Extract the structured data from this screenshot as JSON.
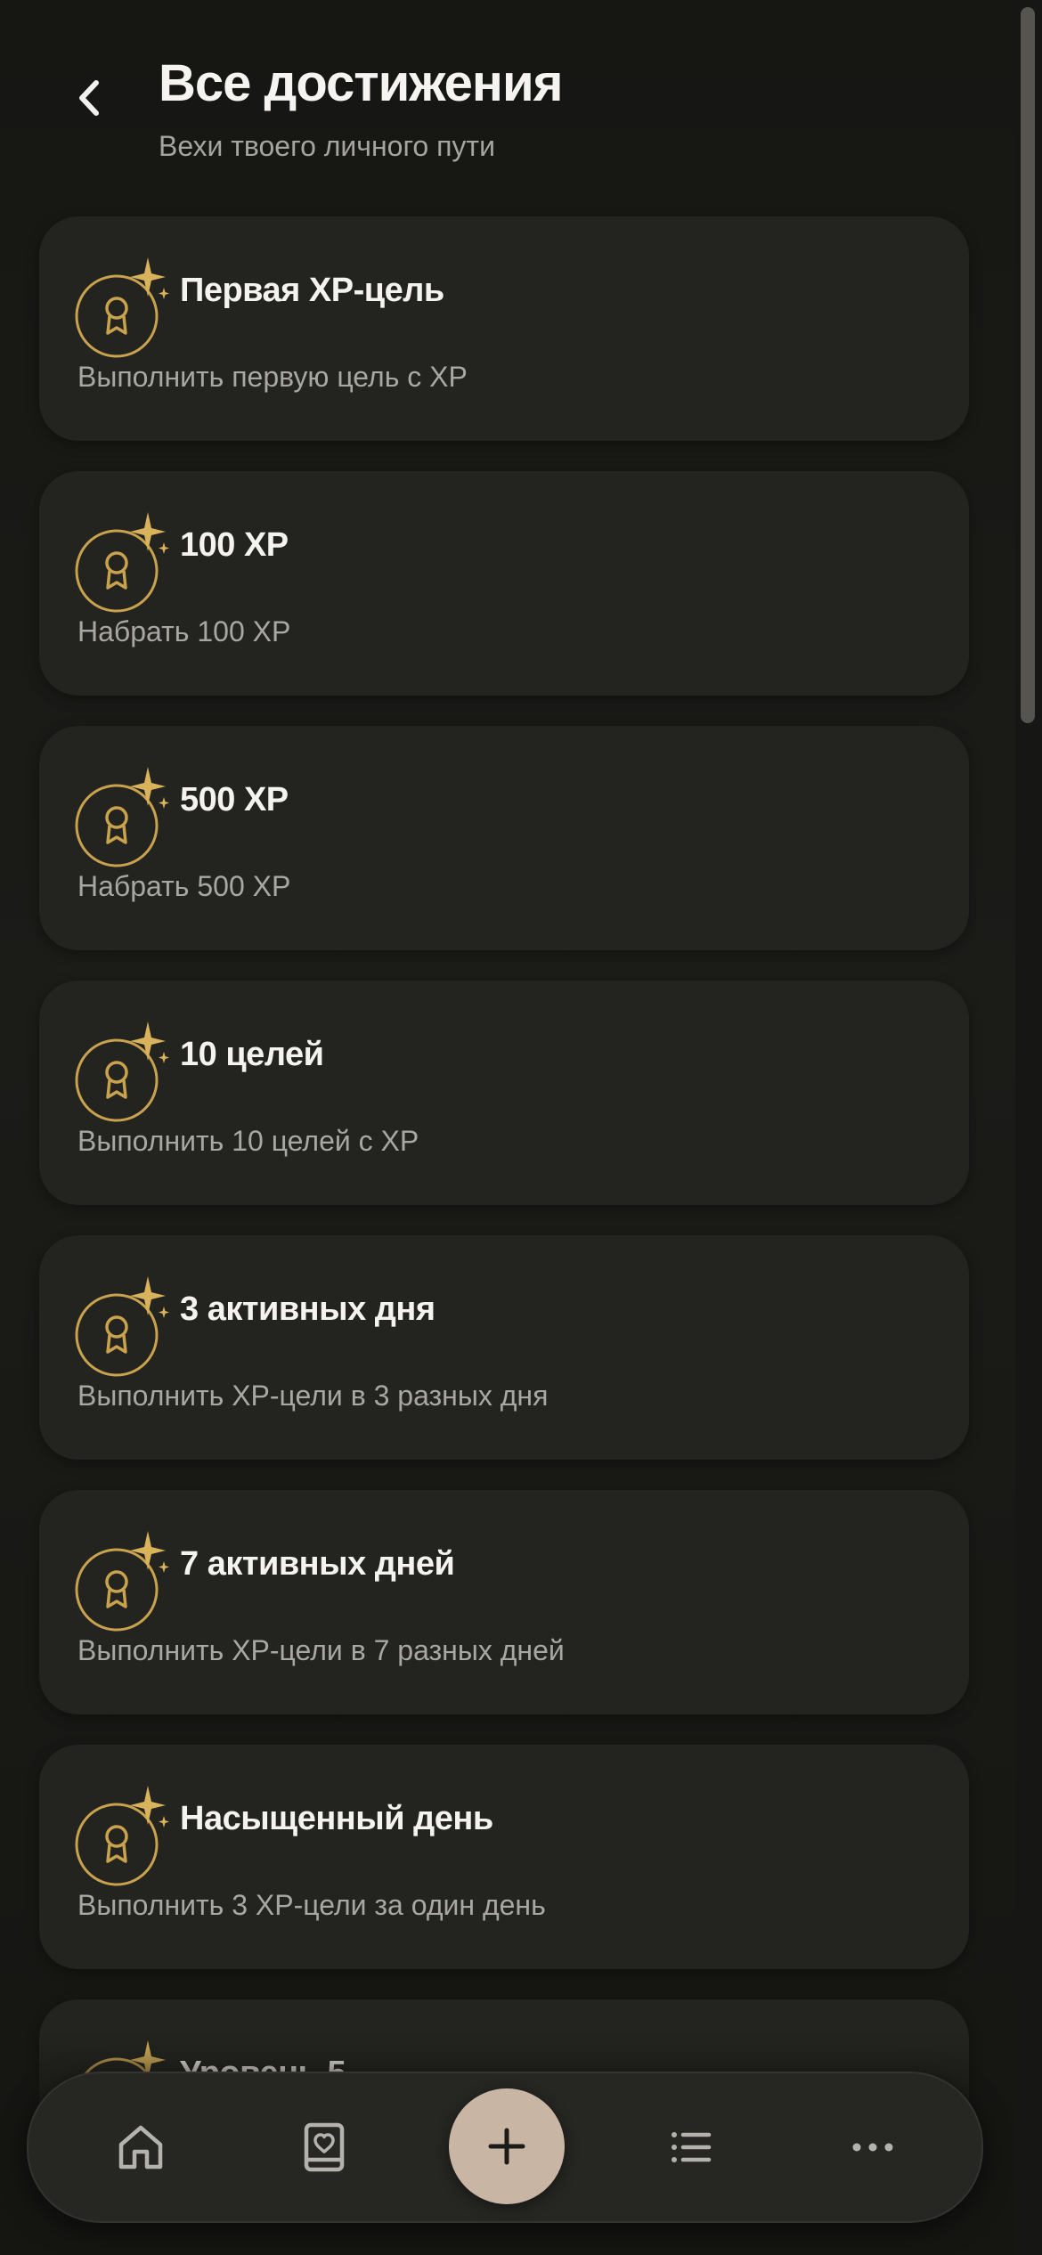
{
  "header": {
    "title": "Все достижения",
    "subtitle": "Вехи твоего личного пути"
  },
  "icons": {
    "back": "chevron-left-icon",
    "achievement": "award-medal-icon",
    "sparkle": "sparkle-icon",
    "home": "home-icon",
    "journal": "journal-heart-icon",
    "add": "plus-icon",
    "list": "list-icon",
    "more": "more-horizontal-icon"
  },
  "colors": {
    "background": "#161613",
    "card": "#232320",
    "accent_gold": "#c9a24e",
    "add_button": "#c9b5a4",
    "text_primary": "#f4f3ef",
    "text_secondary": "#a9a7a1"
  },
  "achievements": [
    {
      "title": "Первая XP-цель",
      "desc": "Выполнить первую цель с XP"
    },
    {
      "title": "100 XP",
      "desc": "Набрать 100 XP"
    },
    {
      "title": "500 XP",
      "desc": "Набрать 500 XP"
    },
    {
      "title": "10 целей",
      "desc": "Выполнить 10 целей с XP"
    },
    {
      "title": "3 активных дня",
      "desc": "Выполнить XP-цели в 3 разных дня"
    },
    {
      "title": "7 активных дней",
      "desc": "Выполнить XP-цели в 7 разных дней"
    },
    {
      "title": "Насыщенный день",
      "desc": "Выполнить 3 XP-цели за один день"
    },
    {
      "title": "Уровень 5",
      "desc": ""
    }
  ]
}
